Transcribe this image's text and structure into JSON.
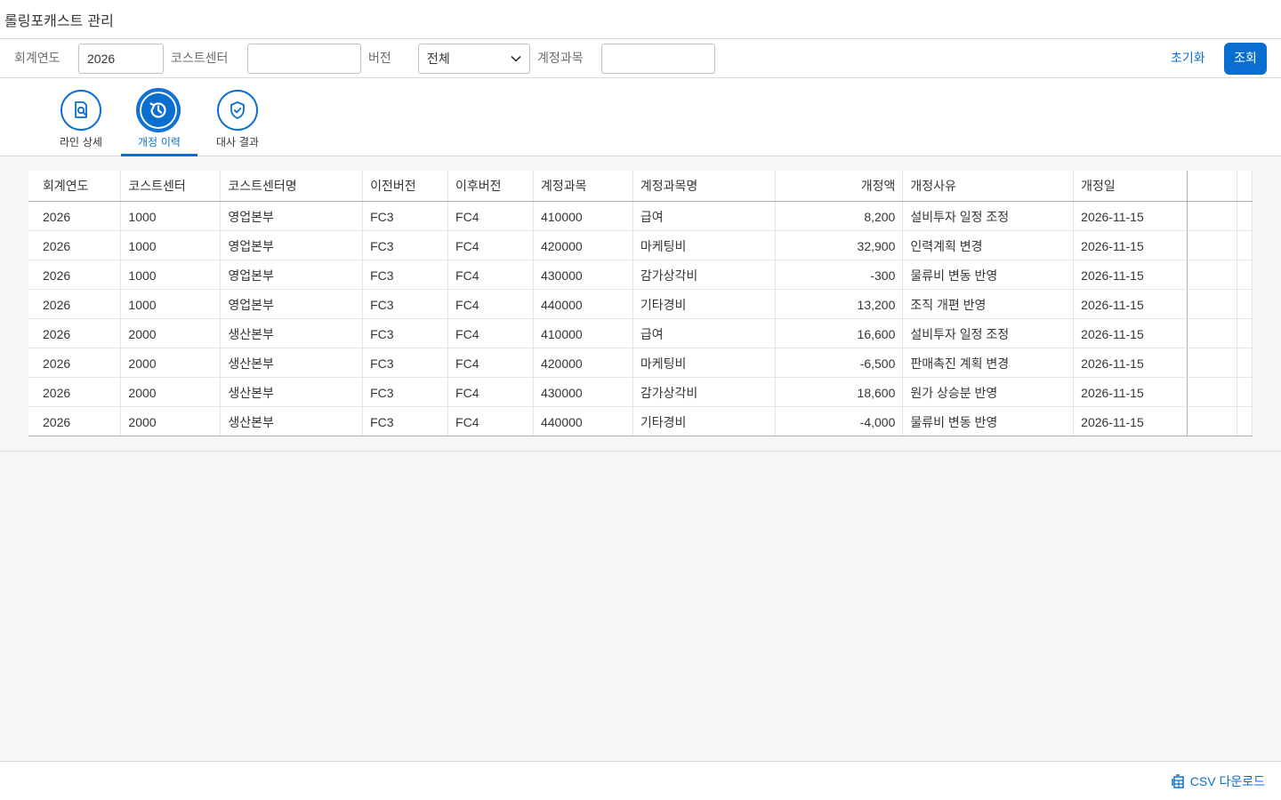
{
  "app": {
    "title": "롤링포캐스트 관리"
  },
  "filters": {
    "year_label": "회계연도",
    "year_value": "2026",
    "cost_center_label": "코스트센터",
    "cost_center_value": "",
    "version_label": "버전",
    "version_value": "전체",
    "account_label": "계정과목",
    "account_value": "",
    "reset_label": "초기화",
    "go_label": "조회"
  },
  "tabs": [
    {
      "label": "라인 상세",
      "icon": "document-search-icon"
    },
    {
      "label": "개정 이력",
      "icon": "history-icon"
    },
    {
      "label": "대사 결과",
      "icon": "shield-check-icon"
    }
  ],
  "active_tab": 1,
  "table": {
    "columns": [
      "회계연도",
      "코스트센터",
      "코스트센터명",
      "이전버전",
      "이후버전",
      "계정과목",
      "계정과목명",
      "개정액",
      "개정사유",
      "개정일"
    ],
    "rows": [
      [
        "2026",
        "1000",
        "영업본부",
        "FC3",
        "FC4",
        "410000",
        "급여",
        "8,200",
        "설비투자 일정 조정",
        "2026-11-15"
      ],
      [
        "2026",
        "1000",
        "영업본부",
        "FC3",
        "FC4",
        "420000",
        "마케팅비",
        "32,900",
        "인력계획 변경",
        "2026-11-15"
      ],
      [
        "2026",
        "1000",
        "영업본부",
        "FC3",
        "FC4",
        "430000",
        "감가상각비",
        "-300",
        "물류비 변동 반영",
        "2026-11-15"
      ],
      [
        "2026",
        "1000",
        "영업본부",
        "FC3",
        "FC4",
        "440000",
        "기타경비",
        "13,200",
        "조직 개편 반영",
        "2026-11-15"
      ],
      [
        "2026",
        "2000",
        "생산본부",
        "FC3",
        "FC4",
        "410000",
        "급여",
        "16,600",
        "설비투자 일정 조정",
        "2026-11-15"
      ],
      [
        "2026",
        "2000",
        "생산본부",
        "FC3",
        "FC4",
        "420000",
        "마케팅비",
        "-6,500",
        "판매촉진 계획 변경",
        "2026-11-15"
      ],
      [
        "2026",
        "2000",
        "생산본부",
        "FC3",
        "FC4",
        "430000",
        "감가상각비",
        "18,600",
        "원가 상승분 반영",
        "2026-11-15"
      ],
      [
        "2026",
        "2000",
        "생산본부",
        "FC3",
        "FC4",
        "440000",
        "기타경비",
        "-4,000",
        "물류비 변동 반영",
        "2026-11-15"
      ]
    ]
  },
  "footer": {
    "csv_label": "CSV 다운로드"
  },
  "colors": {
    "accent": "#0a6ed1",
    "background": "#f5f6f7"
  }
}
